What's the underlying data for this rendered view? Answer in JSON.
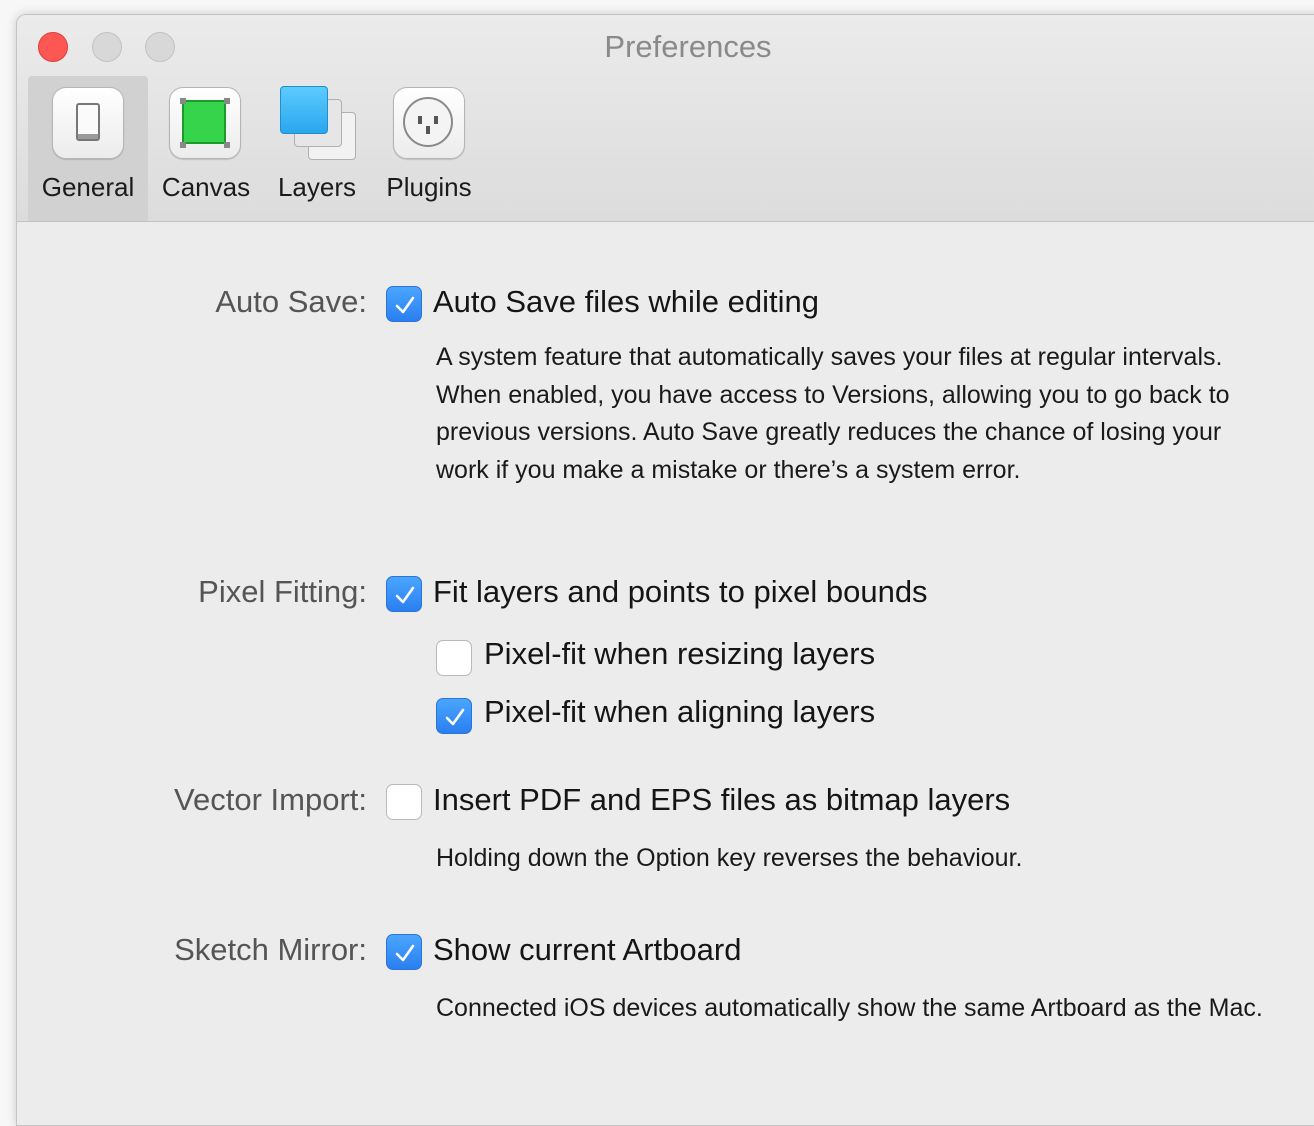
{
  "window": {
    "title": "Preferences"
  },
  "tabs": [
    {
      "label": "General",
      "icon": "switch-icon",
      "selected": true
    },
    {
      "label": "Canvas",
      "icon": "canvas-icon",
      "selected": false
    },
    {
      "label": "Layers",
      "icon": "layers-icon",
      "selected": false
    },
    {
      "label": "Plugins",
      "icon": "plug-icon",
      "selected": false
    }
  ],
  "settings": {
    "auto_save": {
      "label": "Auto Save:",
      "option": "Auto Save files while editing",
      "checked": true,
      "description": "A system feature that automatically saves your files at regular intervals. When enabled, you have access to Versions, allowing you to go back to previous versions. Auto Save greatly reduces the chance of losing your work if you make a mistake or there’s a system error."
    },
    "pixel_fitting": {
      "label": "Pixel Fitting:",
      "option": "Fit layers and points to pixel bounds",
      "checked": true,
      "sub_options": [
        {
          "label": "Pixel-fit when resizing layers",
          "checked": false
        },
        {
          "label": "Pixel-fit when aligning layers",
          "checked": true
        }
      ]
    },
    "vector_import": {
      "label": "Vector Import:",
      "option": "Insert PDF and EPS files as bitmap layers",
      "checked": false,
      "description": "Holding down the Option key reverses the behaviour."
    },
    "sketch_mirror": {
      "label": "Sketch Mirror:",
      "option": "Show current Artboard",
      "checked": true,
      "description": "Connected iOS devices automatically show the same Artboard as the Mac."
    }
  },
  "colors": {
    "checkbox_on": "#2a7ff0",
    "close_button": "#fc5753",
    "canvas_icon_green": "#35d44a",
    "layers_icon_blue": "#39b6f5"
  }
}
